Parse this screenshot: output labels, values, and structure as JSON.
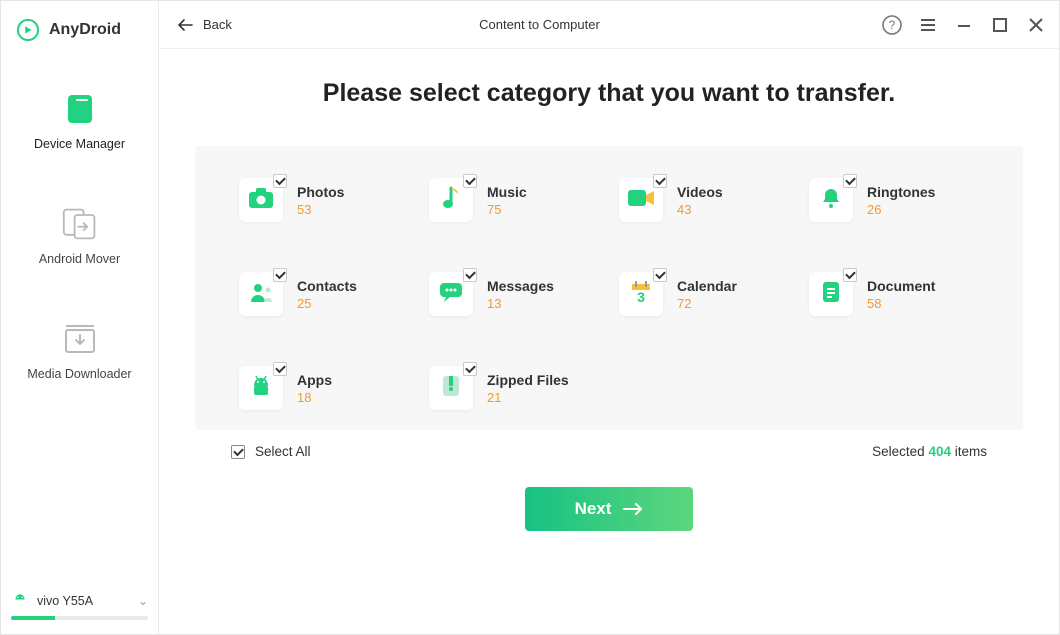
{
  "brand": {
    "name": "AnyDroid"
  },
  "sidebar": {
    "items": [
      {
        "label": "Device Manager",
        "icon": "device-manager-icon"
      },
      {
        "label": "Android Mover",
        "icon": "android-mover-icon"
      },
      {
        "label": "Media Downloader",
        "icon": "media-downloader-icon"
      }
    ]
  },
  "device": {
    "name": "vivo Y55A",
    "storage_pct": 32
  },
  "topbar": {
    "back_label": "Back",
    "title": "Content to Computer"
  },
  "heading": "Please select category that you want to transfer.",
  "categories": [
    {
      "label": "Photos",
      "count": "53",
      "icon": "photos-icon"
    },
    {
      "label": "Music",
      "count": "75",
      "icon": "music-icon"
    },
    {
      "label": "Videos",
      "count": "43",
      "icon": "videos-icon"
    },
    {
      "label": "Ringtones",
      "count": "26",
      "icon": "ringtones-icon"
    },
    {
      "label": "Contacts",
      "count": "25",
      "icon": "contacts-icon"
    },
    {
      "label": "Messages",
      "count": "13",
      "icon": "messages-icon"
    },
    {
      "label": "Calendar",
      "count": "72",
      "icon": "calendar-icon"
    },
    {
      "label": "Document",
      "count": "58",
      "icon": "document-icon"
    },
    {
      "label": "Apps",
      "count": "18",
      "icon": "apps-icon"
    },
    {
      "label": "Zipped Files",
      "count": "21",
      "icon": "zip-icon"
    }
  ],
  "footer": {
    "select_all_label": "Select All",
    "selected_prefix": "Selected ",
    "selected_count": "404",
    "selected_suffix": " items",
    "next_label": "Next"
  },
  "colors": {
    "accent": "#23d27f",
    "orange": "#f39a2d"
  }
}
